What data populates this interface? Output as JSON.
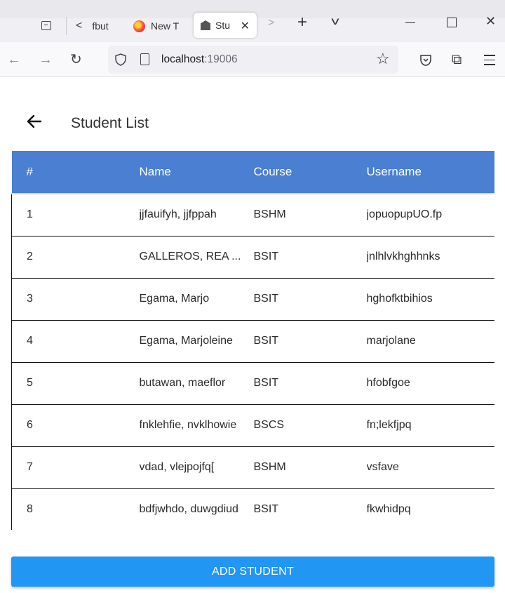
{
  "browser": {
    "tabs": [
      {
        "label": "fbut"
      },
      {
        "label": "New T"
      },
      {
        "label": "Stu"
      }
    ],
    "url_host": "localhost",
    "url_port": ":19006"
  },
  "page": {
    "title": "Student List"
  },
  "table": {
    "headers": [
      "#",
      "Name",
      "Course",
      "Username"
    ],
    "rows": [
      [
        "1",
        "jjfauifyh, jjfppah",
        "BSHM",
        "jopuopupUO.fp"
      ],
      [
        "2",
        "GALLEROS, REA ...",
        "BSIT",
        "jnlhlvkhghhnks"
      ],
      [
        "3",
        "Egama, Marjo",
        "BSIT",
        "hghofktbihios"
      ],
      [
        "4",
        "Egama, Marjoleine",
        "BSIT",
        "marjolane"
      ],
      [
        "5",
        "butawan, maeflor",
        "BSIT",
        "hfobfgoe"
      ],
      [
        "6",
        "fnklehfie, nvklhowie",
        "BSCS",
        "fn;lekfjpq"
      ],
      [
        "7",
        "vdad, vlejpojfq[",
        "BSHM",
        "vsfave"
      ],
      [
        "8",
        "bdfjwhdo, duwgdiud",
        "BSIT",
        "fkwhidpq"
      ]
    ]
  },
  "actions": {
    "add_label": "ADD STUDENT"
  },
  "colors": {
    "header_bg": "#4a7fd1",
    "button_bg": "#2196f3"
  }
}
